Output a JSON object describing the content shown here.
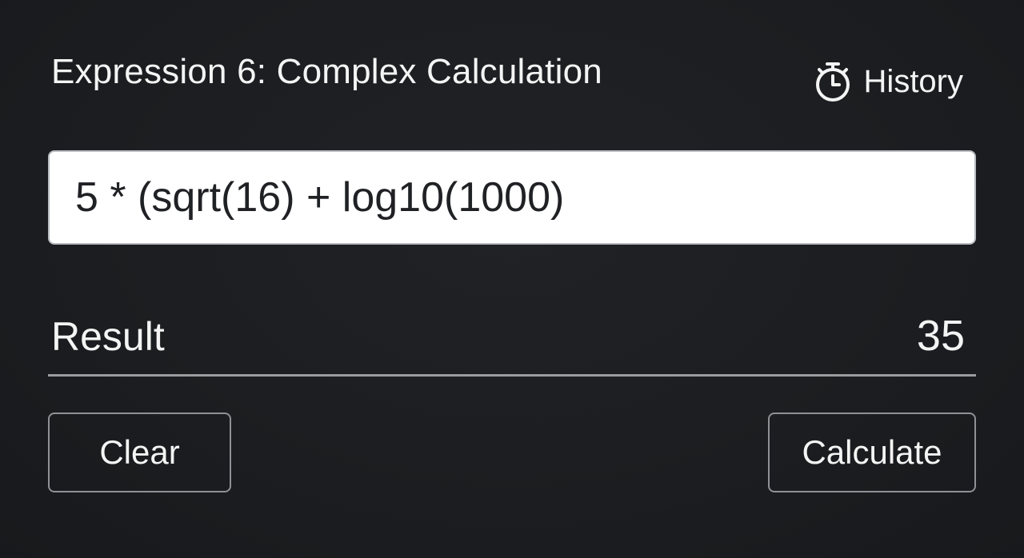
{
  "header": {
    "title": "Expression 6: Complex Calculation",
    "history_label": "History",
    "history_icon": "stopwatch-icon"
  },
  "expression": {
    "value": "5 * (sqrt(16) + log10(1000)"
  },
  "result": {
    "label": "Result",
    "value": "35"
  },
  "actions": {
    "clear_label": "Clear",
    "calculate_label": "Calculate"
  },
  "colors": {
    "background": "#1b1d20",
    "text": "#f4f4f4",
    "input_background": "#ffffff",
    "border": "#8f9196"
  }
}
